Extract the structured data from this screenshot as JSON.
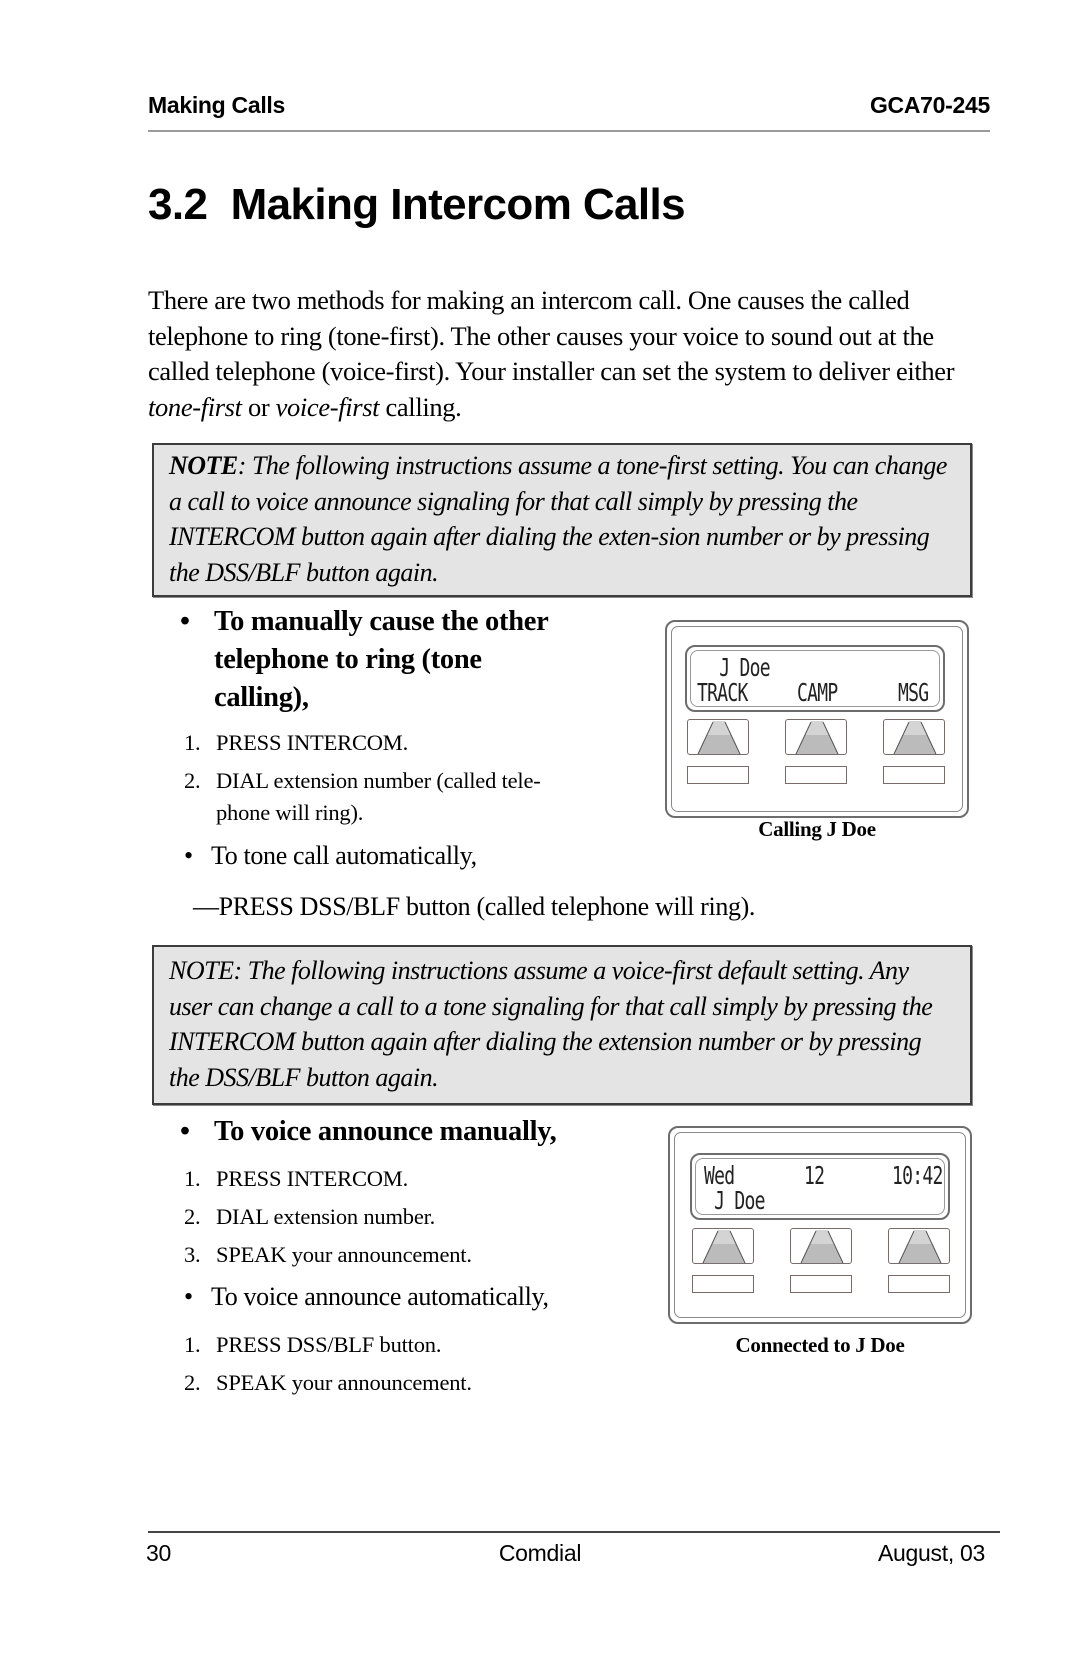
{
  "running_header": {
    "section": "Making Calls",
    "doc_id": "GCA70-245"
  },
  "title": "3.2  Making Intercom Calls",
  "intro": {
    "text_before": "There are two methods for making an intercom call. One causes the called telephone to ring (tone-first). The other causes your voice to sound out at the called telephone (voice-first). Your installer can set the system to deliver either ",
    "em1": "tone-first",
    "mid": " or ",
    "em2": "voice-first",
    "text_after": " calling."
  },
  "note1": {
    "label": "NOTE",
    "text": ": The following instructions assume a tone-first setting. You can change a call to voice announce signaling for that call simply by pressing the INTERCOM button again after dialing the exten-sion number or by pressing the DSS/BLF button again."
  },
  "section_tone": {
    "bullet": "•",
    "heading_lines": [
      "To manually cause the other",
      "telephone to ring (tone",
      "calling),"
    ],
    "steps": [
      {
        "num": "1.",
        "lines": [
          "PRESS INTERCOM."
        ]
      },
      {
        "num": "2.",
        "lines": [
          "DIAL extension number (called tele-",
          "phone will ring)."
        ]
      }
    ],
    "auto_bullet": "•",
    "auto_label": "To tone call automatically,",
    "auto_instruction": "—PRESS DSS/BLF button (called telephone will ring)."
  },
  "phone1": {
    "display_line1": "  J Doe",
    "softkey_labels": [
      "TRACK",
      "CAMP",
      "MSG"
    ],
    "caption": "Calling J Doe"
  },
  "note2": {
    "text": "NOTE: The following instructions assume a voice-first default setting. Any user can change a call to a tone signaling for that call simply by pressing the INTERCOM button again after dialing the extension number or by pressing the DSS/BLF button again."
  },
  "section_voice": {
    "bullet": "•",
    "heading": "To voice announce manually,",
    "steps": [
      {
        "num": "1.",
        "text": "PRESS INTERCOM."
      },
      {
        "num": "2.",
        "text": "DIAL extension number."
      },
      {
        "num": "3.",
        "text": "SPEAK your announcement."
      }
    ],
    "auto_bullet": "•",
    "auto_label": "To voice announce automatically,",
    "auto_steps": [
      {
        "num": "1.",
        "text": "PRESS DSS/BLF button."
      },
      {
        "num": "2.",
        "text": "SPEAK your announcement."
      }
    ]
  },
  "phone2": {
    "display_day": "Wed",
    "display_date": "12",
    "display_time": "10:42",
    "display_line2": " J Doe",
    "caption": "Connected to J Doe"
  },
  "footer": {
    "page_number": "30",
    "publisher": "Comdial",
    "date": "August, 03"
  }
}
